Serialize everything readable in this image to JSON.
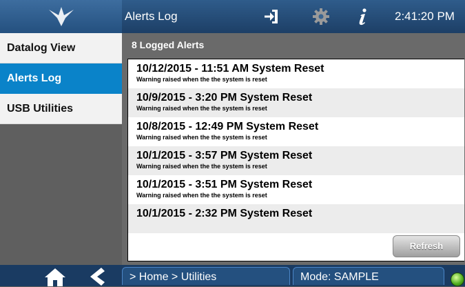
{
  "header": {
    "title": "Alerts Log",
    "clock": "2:41:20 PM",
    "icons": [
      "logout-icon",
      "gear-icon",
      "info-icon"
    ]
  },
  "sidebar": {
    "items": [
      {
        "label": "Datalog View",
        "active": false
      },
      {
        "label": "Alerts Log",
        "active": true
      },
      {
        "label": "USB Utilities",
        "active": false
      }
    ]
  },
  "main": {
    "title": "8 Logged Alerts",
    "alerts": [
      {
        "title": "10/12/2015 - 11:51 AM System Reset",
        "desc": "Warning raised when the the system is reset"
      },
      {
        "title": "10/9/2015 - 3:20 PM System Reset",
        "desc": "Warning raised when the the system is reset"
      },
      {
        "title": "10/8/2015 - 12:49 PM System Reset",
        "desc": "Warning raised when the the system is reset"
      },
      {
        "title": "10/1/2015 - 3:57 PM System Reset",
        "desc": "Warning raised when the the system is reset"
      },
      {
        "title": "10/1/2015 - 3:51 PM System Reset",
        "desc": "Warning raised when the the system is reset"
      },
      {
        "title": "10/1/2015 - 2:32 PM System Reset",
        "desc": ""
      }
    ],
    "refresh_label": "Refresh"
  },
  "footer": {
    "breadcrumb": "> Home > Utilities",
    "mode": "Mode: SAMPLE",
    "icons": [
      "home-icon",
      "back-icon",
      "status-light-icon"
    ]
  },
  "colors": {
    "header_bg": "#1d3f66",
    "active_item": "#0a83c9",
    "status_ok": "#4caa1c"
  }
}
